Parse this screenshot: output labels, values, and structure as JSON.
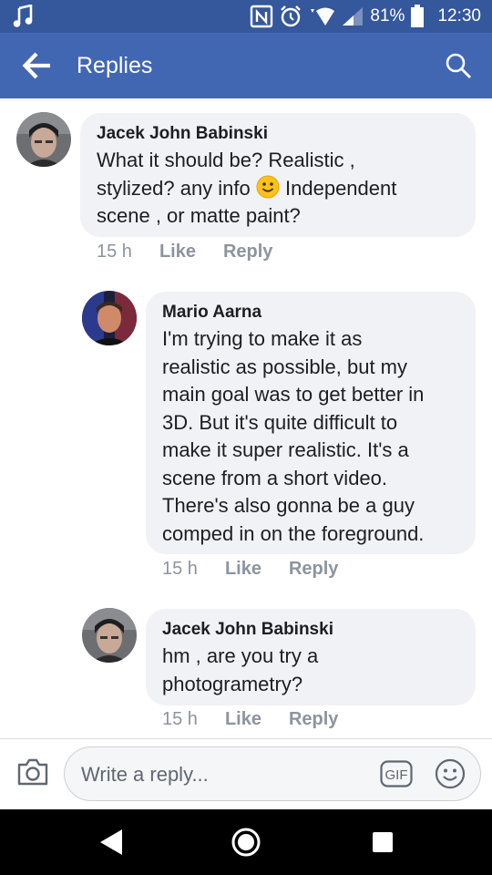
{
  "status_bar": {
    "battery": "81%",
    "time": "12:30",
    "icons": [
      "music-icon",
      "nfc-icon",
      "alarm-icon",
      "wifi-icon",
      "signal-icon",
      "battery-icon"
    ]
  },
  "header": {
    "title": "Replies",
    "back_icon": "arrow-left-icon",
    "search_icon": "search-icon"
  },
  "comments": [
    {
      "author": "Jacek John Babinski",
      "text_before_emoji": "What it should be? Realistic ,",
      "text_line2": "stylized? any info",
      "text_after_emoji": "Independent",
      "text_line3": "scene , or matte paint?",
      "time": "15 h",
      "like": "Like",
      "reply": "Reply"
    },
    {
      "author": "Mario Aarna",
      "lines": [
        "I'm trying to make it as",
        "realistic as possible, but my",
        "main goal was to get better in",
        "3D. But it's quite difficult to",
        "make it super realistic. It's a",
        "scene from a short video.",
        "There's also gonna be a guy",
        "comped in on the foreground."
      ],
      "time": "15 h",
      "like": "Like",
      "reply": "Reply"
    },
    {
      "author": "Jacek John Babinski",
      "lines": [
        "hm , are you try a",
        "photogrametry?"
      ],
      "time": "15 h",
      "like": "Like",
      "reply": "Reply"
    }
  ],
  "composer": {
    "placeholder": "Write a reply...",
    "camera_icon": "camera-icon",
    "gif_label": "GIF",
    "emoji_icon": "smiley-icon"
  },
  "nav_bar": {
    "icons": [
      "back-triangle-icon",
      "home-circle-icon",
      "recents-square-icon"
    ]
  },
  "colors": {
    "header_bg": "#4267b2",
    "status_bg": "#35579b",
    "bubble_bg": "#f1f2f6",
    "meta_text": "#8d949e"
  }
}
